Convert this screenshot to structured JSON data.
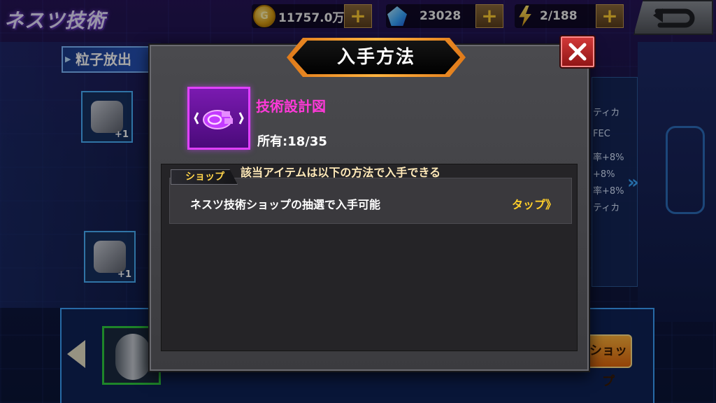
{
  "header": {
    "game_title": "ネスツ技術",
    "section_tab": "粒子放出"
  },
  "resources": {
    "gold": "11757.0万",
    "crystal": "23028",
    "energy": "2/188",
    "plus": "+"
  },
  "background": {
    "right_stats": [
      "ティカ",
      "FEC",
      "率+8%",
      "+8%",
      "率+8%",
      "ティカ"
    ],
    "slot_count": "+1",
    "shop_button": "ショップ"
  },
  "modal": {
    "title": "入手方法",
    "item_name": "技術設計図",
    "owned_label": "所有:",
    "owned_value": "18/35",
    "notice": "該当アイテムは以下の方法で入手できる",
    "sources": [
      {
        "tag": "ショップ",
        "description": "ネスツ技術ショップの抽選で入手可能",
        "action": "タップ》"
      }
    ]
  },
  "colors": {
    "item_name": "#ff39d9",
    "tap_link": "#ffcf2a",
    "title_border": "#ffb340",
    "close_red": "#d43a3a"
  }
}
